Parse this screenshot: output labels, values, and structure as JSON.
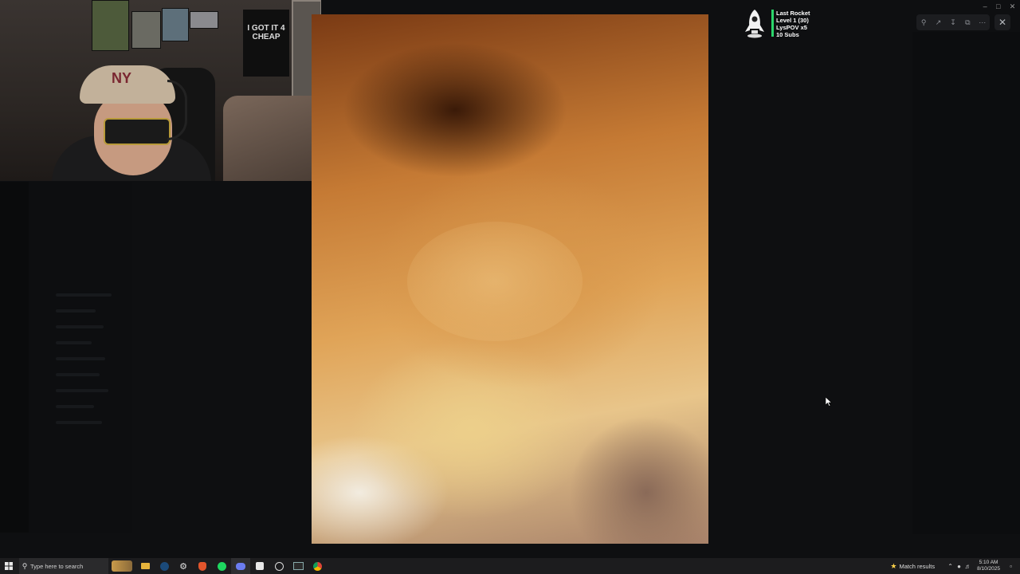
{
  "alert": {
    "lines": [
      "Last Rocket",
      "Level 1  (30)",
      "LysPOV x5",
      "10 Subs"
    ]
  },
  "webcam": {
    "shirt_text": "I GOT IT 4 CHEAP",
    "cap_logo": "NY"
  },
  "viewer_toolbar": {
    "icons": [
      "zoom-icon",
      "share-icon",
      "download-icon",
      "open-external-icon",
      "more-icon"
    ],
    "close_icon": "close-icon"
  },
  "taskbar": {
    "search_placeholder": "Type here to search",
    "match_results": "Match results",
    "time": "5:10 AM",
    "date": "8/10/2025"
  },
  "colors": {
    "accent_green": "#2bd66b",
    "taskbar_bg": "#1c1c1e"
  }
}
